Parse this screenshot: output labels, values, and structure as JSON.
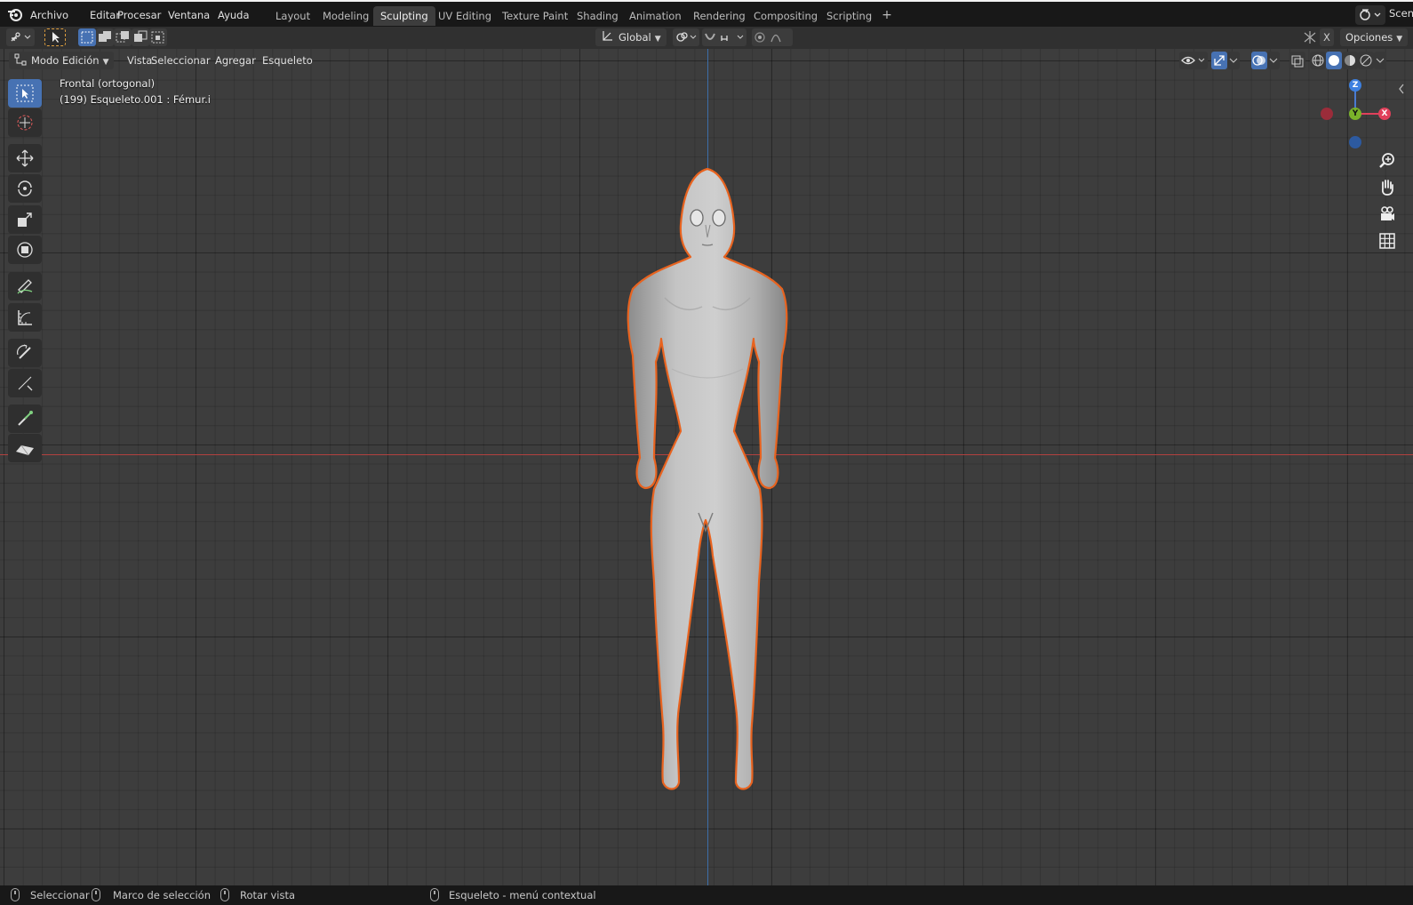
{
  "menubar": {
    "items": [
      "Archivo",
      "Editar",
      "Procesar",
      "Ventana",
      "Ayuda"
    ]
  },
  "workspaces": {
    "tabs": [
      "Layout",
      "Modeling",
      "Sculpting",
      "UV Editing",
      "Texture Paint",
      "Shading",
      "Animation",
      "Rendering",
      "Compositing",
      "Scripting"
    ],
    "active": "Sculpting",
    "add_label": "+"
  },
  "scene": {
    "label": "Scene"
  },
  "toolheader": {
    "orientation": "Global",
    "xray_label": "X",
    "options_label": "Opciones"
  },
  "viewport_header": {
    "mode": "Modo Edición",
    "menus": [
      "Vista",
      "Seleccionar",
      "Agregar",
      "Esqueleto"
    ]
  },
  "overlay_info": {
    "view_name": "Frontal (ortogonal)",
    "object_info": "(199) Esqueleto.001 : Fémur.i"
  },
  "gizmo": {
    "z": "Z",
    "y": "Y",
    "x": "X"
  },
  "statusbar": {
    "select": "Seleccionar",
    "box_select": "Marco de selección",
    "rotate": "Rotar vista",
    "context": "Esqueleto - menú contextual"
  },
  "colors": {
    "accent": "#4772b3",
    "selection_outline": "#e8631f",
    "axis_x": "#b3413f",
    "axis_z": "#3d6ea8"
  }
}
